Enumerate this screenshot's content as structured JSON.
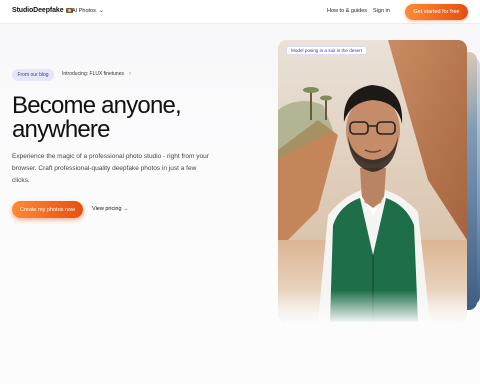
{
  "nav": {
    "logo_text": "StudioDeepfake",
    "logo_icon": "camera-icon",
    "ai_photos_label": "AI Photos",
    "how_to_label": "How to & guides",
    "signin_label": "Sign in",
    "cta_label": "Get started for free"
  },
  "hero": {
    "pill_label": "From our blog",
    "blog_link": "Introducing: FLUX finetunes",
    "headline_line1": "Become anyone,",
    "headline_line2": "anywhere",
    "description": "Experience the magic of a professional photo studio - right from your browser. Craft professional-quality deepfake photos in just a few clicks.",
    "primary_cta": "Create my photos now",
    "secondary_cta": "View pricing →"
  },
  "photo": {
    "caption": "Model posing in a suit in the desert"
  },
  "colors": {
    "accent_start": "#ff8a34",
    "accent_end": "#e64f12",
    "pill_bg": "#e6e6f7",
    "pill_text": "#3b3b99"
  }
}
